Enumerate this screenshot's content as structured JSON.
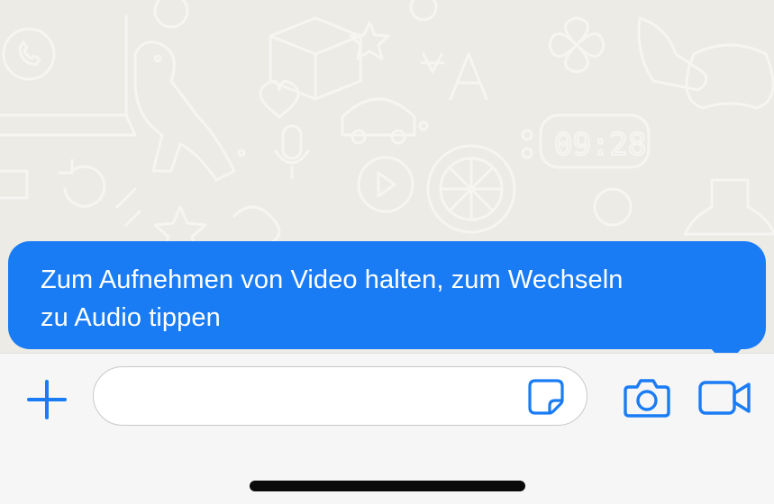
{
  "tooltip": {
    "line1": "Zum Aufnehmen von Video halten, zum Wechseln",
    "line2": "zu Audio tippen"
  },
  "composer": {
    "message_value": "",
    "plus_icon": "plus-icon",
    "sticker_icon": "sticker-icon",
    "camera_icon": "camera-icon",
    "video_icon": "video-camera-icon"
  },
  "background_doodle": {
    "clock_text": "09:28"
  },
  "colors": {
    "accent": "#1a7cf5",
    "chat_background": "#ecebe6",
    "composer_background": "#f6f6f6"
  }
}
